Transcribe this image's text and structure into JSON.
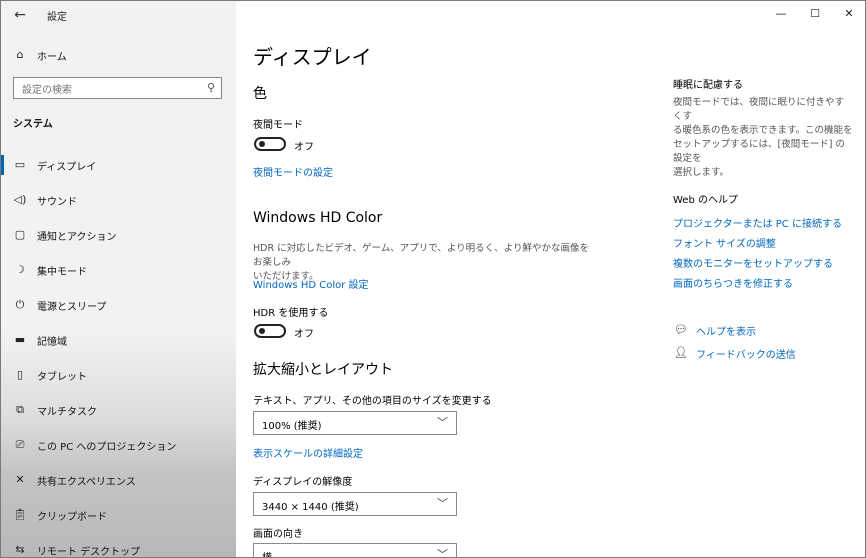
{
  "window": {
    "title": "設定",
    "controls": {
      "minimize": "—",
      "maximize": "☐",
      "close": "✕"
    }
  },
  "sidebar": {
    "home_label": "ホーム",
    "search_placeholder": "設定の検索",
    "section_title": "システム",
    "items": [
      {
        "label": "ディスプレイ",
        "icon": "monitor-icon",
        "active": true
      },
      {
        "label": "サウンド",
        "icon": "speaker-icon"
      },
      {
        "label": "通知とアクション",
        "icon": "notification-icon"
      },
      {
        "label": "集中モード",
        "icon": "moon-icon"
      },
      {
        "label": "電源とスリープ",
        "icon": "power-icon"
      },
      {
        "label": "記憶域",
        "icon": "storage-icon"
      },
      {
        "label": "タブレット",
        "icon": "tablet-icon"
      },
      {
        "label": "マルチタスク",
        "icon": "multitask-icon"
      },
      {
        "label": "この PC へのプロジェクション",
        "icon": "projection-icon"
      },
      {
        "label": "共有エクスペリエンス",
        "icon": "shared-icon"
      },
      {
        "label": "クリップボード",
        "icon": "clipboard-icon"
      },
      {
        "label": "リモート デスクトップ",
        "icon": "remote-icon"
      }
    ]
  },
  "main": {
    "title": "ディスプレイ",
    "color_section": {
      "heading": "色",
      "night_label": "夜間モード",
      "night_state": "オフ",
      "night_link": "夜間モードの設定"
    },
    "hdr_section": {
      "heading": "Windows HD Color",
      "desc_line1": "HDR に対応したビデオ、ゲーム、アプリで、より明るく、より鮮やかな画像をお楽しみ",
      "desc_line2": "いただけます。",
      "link": "Windows HD Color 設定",
      "use_label": "HDR を使用する",
      "use_state": "オフ"
    },
    "scale_section": {
      "heading": "拡大縮小とレイアウト",
      "size_label": "テキスト、アプリ、その他の項目のサイズを変更する",
      "size_value": "100% (推奨)",
      "scale_link": "表示スケールの詳細設定",
      "resolution_label": "ディスプレイの解像度",
      "resolution_value": "3440 × 1440 (推奨)",
      "orientation_label": "画面の向き",
      "orientation_value": "横"
    }
  },
  "right": {
    "sleep_heading": "睡眠に配慮する",
    "sleep_desc": [
      "夜間モードでは、夜間に眠りに付きやすくす",
      "る暖色系の色を表示できます。この機能を",
      "セットアップするには、[夜間モード] の設定を",
      "選択します。"
    ],
    "web_heading": "Web のヘルプ",
    "links": [
      "プロジェクターまたは PC に接続する",
      "フォント サイズの調整",
      "複数のモニターをセットアップする",
      "画面のちらつきを修正する"
    ],
    "help_label": "ヘルプを表示",
    "feedback_label": "フィードバックの送信"
  }
}
